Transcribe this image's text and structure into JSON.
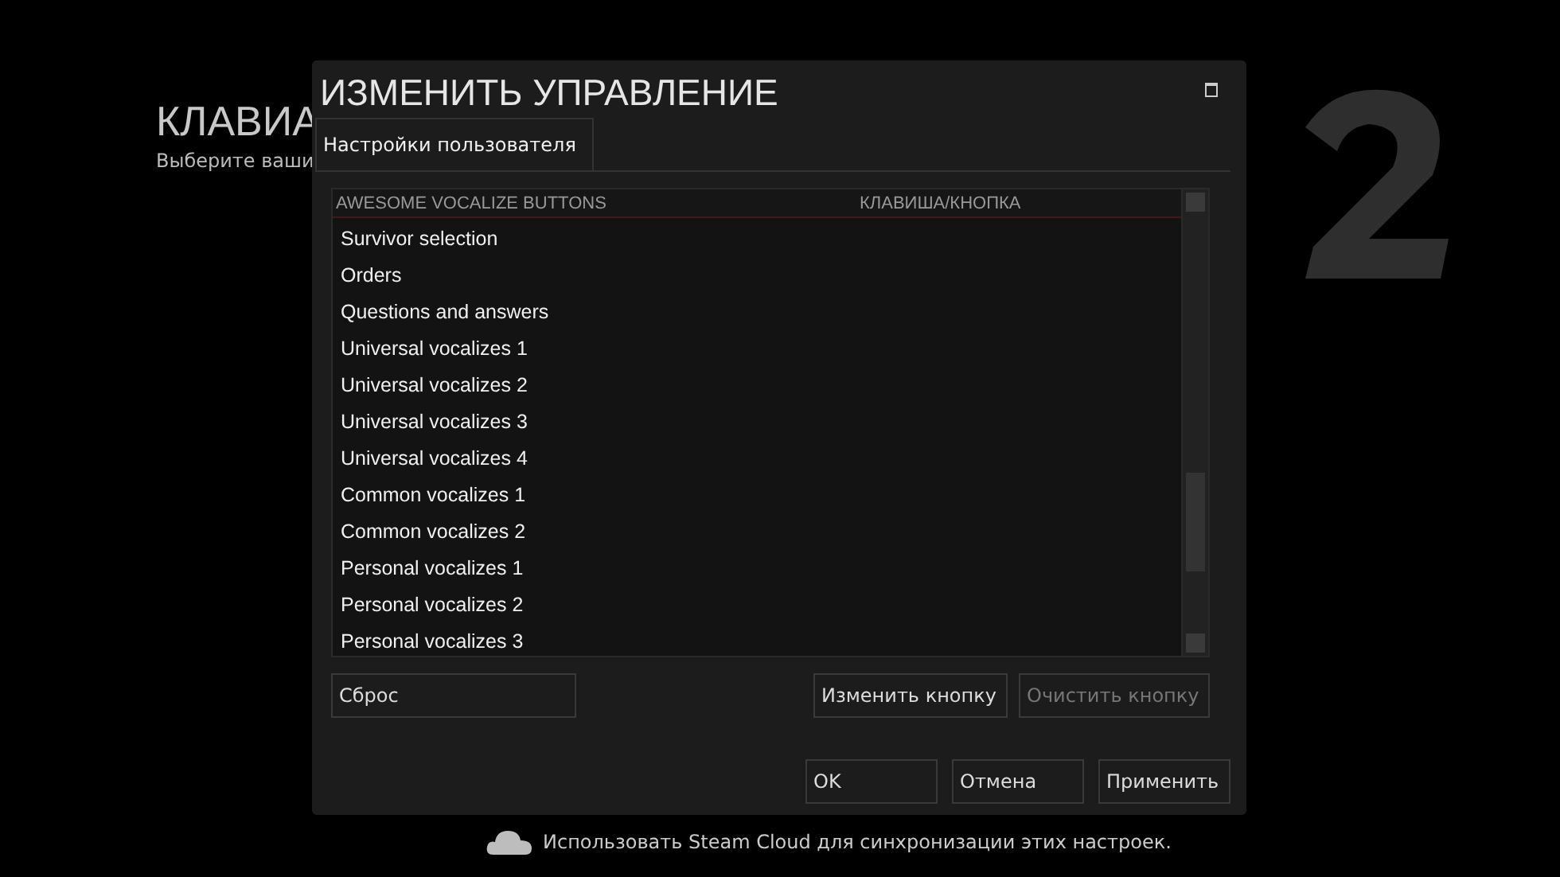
{
  "background": {
    "heading": "КЛАВИА",
    "subtitle": "Выберите ваши"
  },
  "dialog": {
    "title": "ИЗМЕНИТЬ УПРАВЛЕНИЕ",
    "tabs": [
      {
        "label": "Настройки пользователя",
        "selected": true
      }
    ],
    "table": {
      "columns": [
        "AWESOME VOCALIZE BUTTONS",
        "КЛАВИША/КНОПКА"
      ],
      "rows": [
        "Survivor selection",
        "Orders",
        "Questions and answers",
        "Universal vocalizes 1",
        "Universal vocalizes 2",
        "Universal vocalizes 3",
        "Universal vocalizes 4",
        "Common vocalizes 1",
        "Common vocalizes 2",
        "Personal vocalizes 1",
        "Personal vocalizes 2",
        "Personal vocalizes 3"
      ]
    },
    "list_buttons": [
      {
        "label": "Сброс",
        "disabled": false
      },
      {
        "label": "Изменить кнопку",
        "disabled": false
      },
      {
        "label": "Очистить кнопку",
        "disabled": true
      }
    ],
    "footer_buttons": [
      {
        "label": "OK",
        "disabled": false
      },
      {
        "label": "Отмена",
        "disabled": false
      },
      {
        "label": "Применить",
        "disabled": false
      }
    ]
  },
  "cloud_note": "Использовать Steam Cloud для синхронизации этих настроек."
}
